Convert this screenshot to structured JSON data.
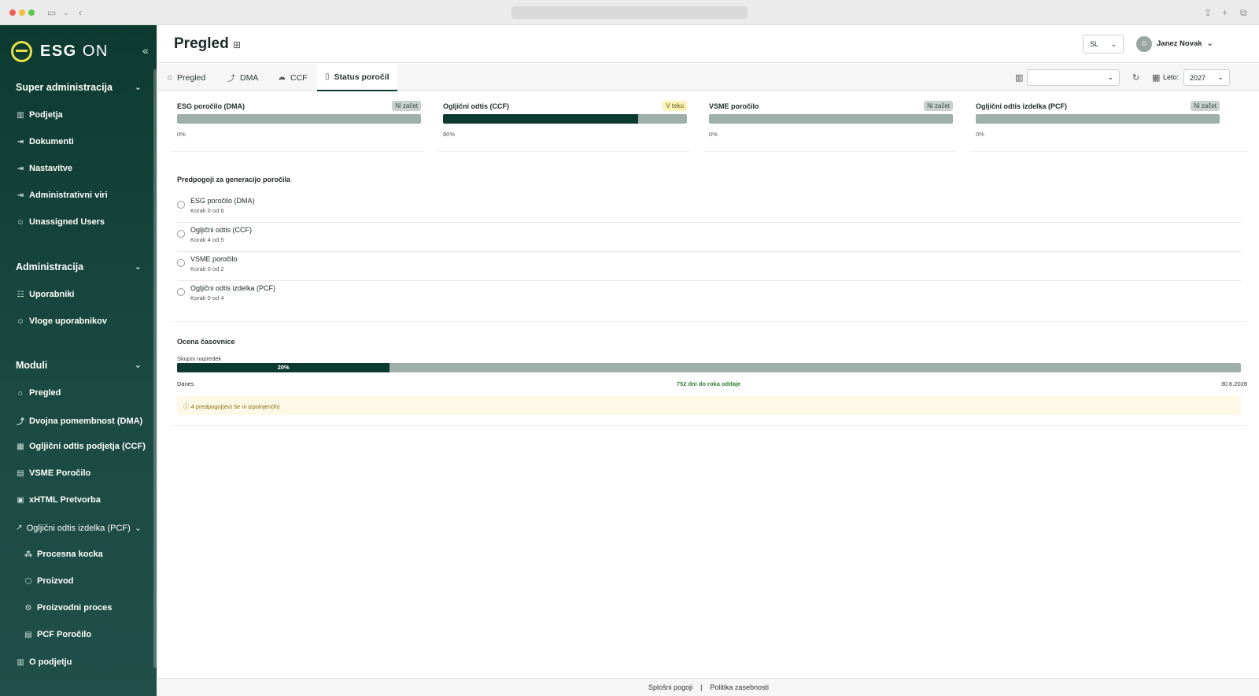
{
  "sidebar": {
    "brand_strong": "ESG",
    "brand_light": "ON",
    "sections": [
      {
        "label": "Super administracija",
        "items": [
          "Podjetja",
          "Dokumenti",
          "Nastavitve",
          "Administrativni viri",
          "Unassigned Users"
        ]
      },
      {
        "label": "Administracija",
        "items": [
          "Uporabniki",
          "Vloge uporabnikov"
        ]
      },
      {
        "label": "Moduli",
        "items": [
          "Pregled",
          "Dvojna pomembnost (DMA)",
          "Ogljični odtis podjetja (CCF)",
          "VSME Poročilo",
          "xHTML Pretvorba",
          "Ogljični odtis izdelka (PCF)"
        ]
      }
    ],
    "pcf_sub": [
      "Procesna kocka",
      "Proizvod",
      "Proizvodni proces",
      "PCF Poročilo"
    ],
    "bottom": "O podjetju"
  },
  "header": {
    "title": "Pregled",
    "language": "SL",
    "user": "Janez Novak"
  },
  "tabs": [
    "Pregled",
    "DMA",
    "CCF",
    "Status poročil"
  ],
  "toolbar": {
    "company_select": "",
    "year_label": "Leto:",
    "year": "2027"
  },
  "reports": [
    {
      "name": "ESG poročilo (DMA)",
      "status": "Ni začet",
      "progress_percent": 0,
      "pct_label": "0%"
    },
    {
      "name": "Ogljični odtis (CCF)",
      "status": "V teku",
      "progress_percent": 80,
      "pct_label": "80%"
    },
    {
      "name": "VSME poročilo",
      "status": "Ni začet",
      "progress_percent": 0,
      "pct_label": "0%"
    },
    {
      "name": "Ogljični odtis izdelka (PCF)",
      "status": "Ni začet",
      "progress_percent": 0,
      "pct_label": "0%"
    }
  ],
  "prerequisites": {
    "title": "Predpogoji za generacijo poročila",
    "items": [
      {
        "name": "ESG poročilo (DMA)",
        "step": "Korak 0 od 6"
      },
      {
        "name": "Ogljični odtis (CCF)",
        "step": "Korak 4 od 5"
      },
      {
        "name": "VSME poročilo",
        "step": "Korak 0 od 2"
      },
      {
        "name": "Ogljični odtis izdelka (PCF)",
        "step": "Korak 0 od 4"
      }
    ]
  },
  "timeline": {
    "title": "Ocena časovnice",
    "label": "Skupni napredek",
    "progress_percent": 20,
    "progress_label": "20%",
    "start": "Danes",
    "remaining": "752 dni do roka oddaje",
    "deadline": "30.6.2028",
    "warning": "4 predpogoj(ev) še ni izpolnjen(ih)"
  },
  "footer": {
    "terms": "Splošni pogoji",
    "separator": "|",
    "privacy": "Politika zasebnosti"
  },
  "colors": {
    "brand": "#0d3a30",
    "accent": "#e5e14a",
    "track": "#9fb0aa",
    "warning_bg": "#fdf9e6"
  },
  "icons": {
    "title": "grid-icon",
    "refresh": "refresh-icon",
    "calendar": "calendar-icon",
    "building": "building-icon"
  }
}
